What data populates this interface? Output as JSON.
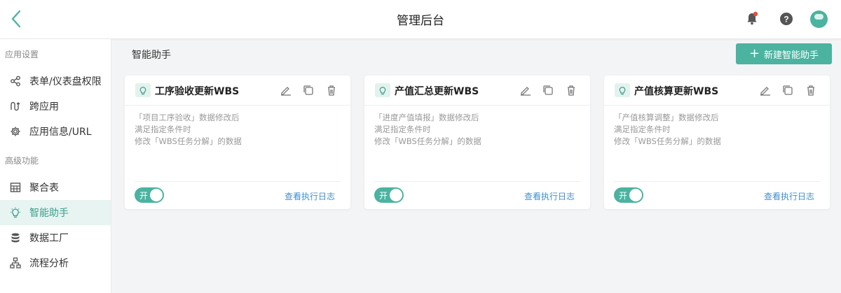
{
  "header": {
    "title": "管理后台"
  },
  "sidebar": {
    "section1": "应用设置",
    "section2": "高级功能",
    "items": [
      {
        "label": "表单/仪表盘权限",
        "icon": "share-icon"
      },
      {
        "label": "跨应用",
        "icon": "cross-app-icon"
      },
      {
        "label": "应用信息/URL",
        "icon": "gear-icon"
      },
      {
        "label": "聚合表",
        "icon": "table-icon"
      },
      {
        "label": "智能助手",
        "icon": "bulb-icon",
        "active": true
      },
      {
        "label": "数据工厂",
        "icon": "database-icon"
      },
      {
        "label": "流程分析",
        "icon": "flow-icon"
      }
    ]
  },
  "main": {
    "page_title": "智能助手",
    "new_button": "新建智能助手",
    "cards": [
      {
        "name": "工序验收更新WBS",
        "lines": [
          "「项目工序验收」数据修改后",
          "满足指定条件时",
          "修改「WBS任务分解」的数据"
        ],
        "toggle": "开",
        "log": "查看执行日志"
      },
      {
        "name": "产值汇总更新WBS",
        "lines": [
          "「进度产值填报」数据修改后",
          "满足指定条件时",
          "修改「WBS任务分解」的数据"
        ],
        "toggle": "开",
        "log": "查看执行日志"
      },
      {
        "name": "产值核算更新WBS",
        "lines": [
          "「产值核算调整」数据修改后",
          "满足指定条件时",
          "修改「WBS任务分解」的数据"
        ],
        "toggle": "开",
        "log": "查看执行日志"
      }
    ]
  },
  "colors": {
    "accent": "#4bb3a0",
    "link": "#3f8fd0",
    "notify": "#e74c3c"
  }
}
